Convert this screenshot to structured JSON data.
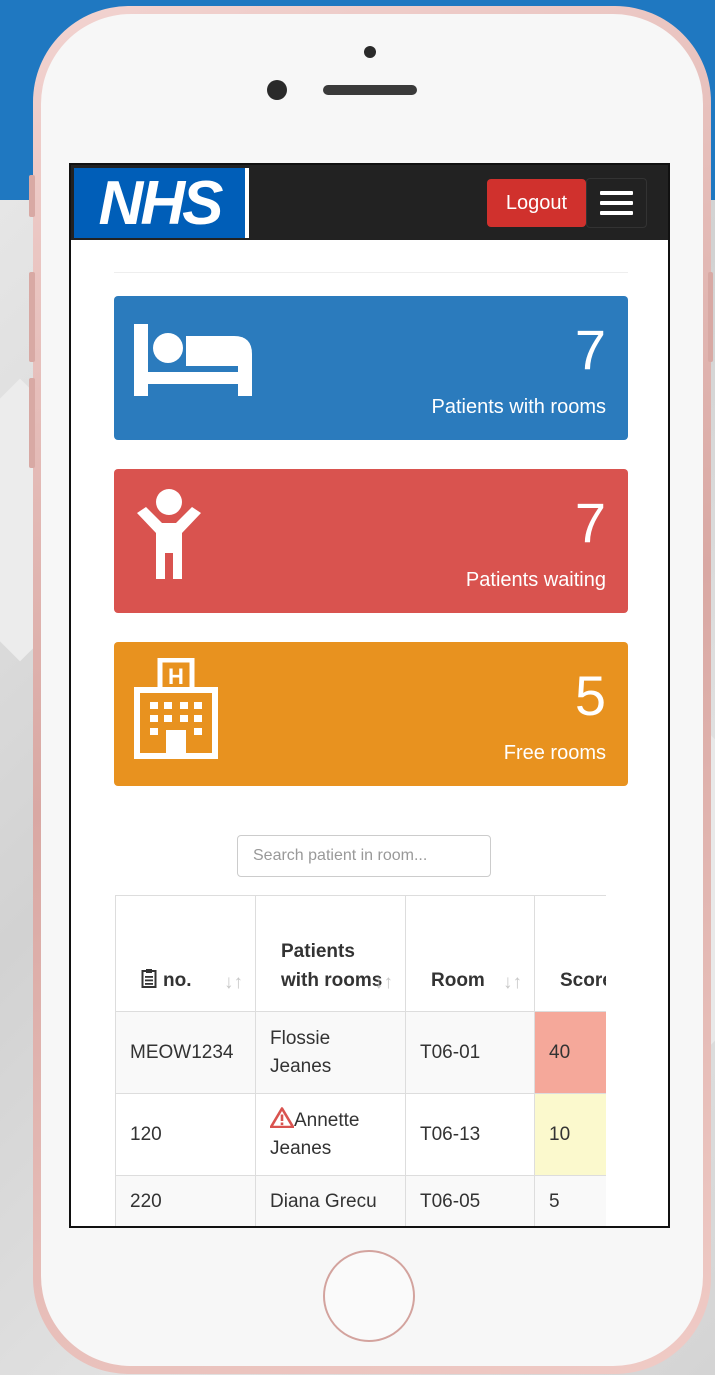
{
  "header": {
    "logo_text": "NHS",
    "logout_label": "Logout",
    "menu_icon": "hamburger-icon"
  },
  "stats": [
    {
      "value": "7",
      "label": "Patients with rooms",
      "icon": "bed-icon",
      "color": "#2b7bbd"
    },
    {
      "value": "7",
      "label": "Patients waiting",
      "icon": "person-icon",
      "color": "#d9534f"
    },
    {
      "value": "5",
      "label": "Free rooms",
      "icon": "hospital-icon",
      "color": "#e8921f"
    }
  ],
  "search": {
    "placeholder": "Search patient in room..."
  },
  "table": {
    "columns": [
      {
        "label": "no.",
        "icon": "clipboard-icon"
      },
      {
        "label": "Patients with rooms"
      },
      {
        "label": "Room"
      },
      {
        "label": "Score"
      }
    ],
    "rows": [
      {
        "no": "MEOW1234",
        "patient": "Flossie Jeanes",
        "room": "T06-01",
        "score": "40",
        "score_color": "#f5a89a",
        "warning": false
      },
      {
        "no": "120",
        "patient": "Annette Jeanes",
        "room": "T06-13",
        "score": "10",
        "score_color": "#fbf9cd",
        "warning": true
      },
      {
        "no": "220",
        "patient": "Diana Grecu",
        "room": "T06-05",
        "score": "5",
        "warning": false
      }
    ]
  },
  "colors": {
    "brand": "#005eb8",
    "navbar": "#222222",
    "logout": "#d0312d",
    "warning_icon": "#d9534f"
  }
}
